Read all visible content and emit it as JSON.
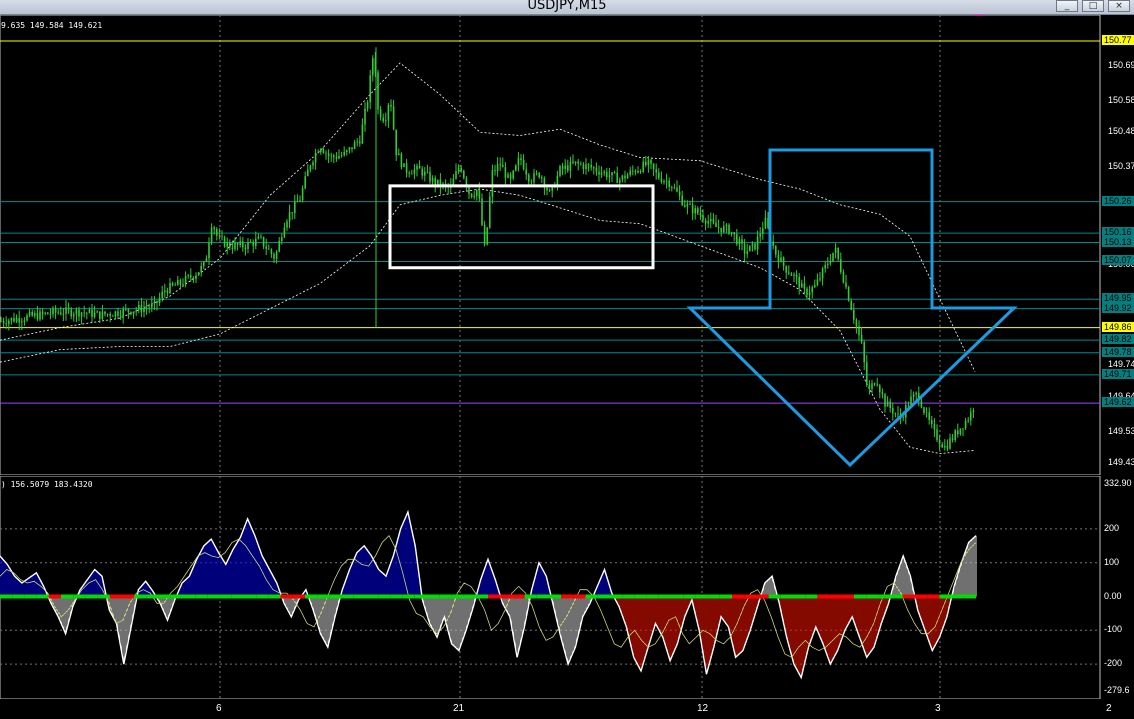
{
  "window": {
    "title": "USDJPY,M15",
    "buttons": {
      "minimize": "_",
      "maximize": "□",
      "close": "×"
    }
  },
  "price_info": "9.635 149.584 149.621",
  "indicator_info": ") 156.5079 183.4320",
  "price_axis": {
    "ticks": [
      {
        "label": "150.69",
        "value": 150.69
      },
      {
        "label": "150.58",
        "value": 150.58
      },
      {
        "label": "150.48",
        "value": 150.48
      },
      {
        "label": "150.37",
        "value": 150.37
      },
      {
        "label": "150.06",
        "value": 150.06
      },
      {
        "label": "149.74",
        "value": 149.74
      },
      {
        "label": "149.64",
        "value": 149.64
      },
      {
        "label": "149.53",
        "value": 149.53
      },
      {
        "label": "149.43",
        "value": 149.43
      }
    ],
    "highlighted_labels": [
      {
        "label": "150.77",
        "value": 150.77,
        "color": "#ffff00"
      },
      {
        "label": "150.26",
        "value": 150.26,
        "color": "#008080"
      },
      {
        "label": "150.16",
        "value": 150.16,
        "color": "#008080"
      },
      {
        "label": "150.13",
        "value": 150.13,
        "color": "#008080"
      },
      {
        "label": "150.07",
        "value": 150.07,
        "color": "#008080"
      },
      {
        "label": "149.95",
        "value": 149.95,
        "color": "#008080"
      },
      {
        "label": "149.92",
        "value": 149.92,
        "color": "#008080"
      },
      {
        "label": "149.86",
        "value": 149.86,
        "color": "#ffff00"
      },
      {
        "label": "149.82",
        "value": 149.82,
        "color": "#008080"
      },
      {
        "label": "149.78",
        "value": 149.78,
        "color": "#008080"
      },
      {
        "label": "149.71",
        "value": 149.71,
        "color": "#008080"
      },
      {
        "label": "149.62",
        "value": 149.62,
        "color": "#008080"
      }
    ]
  },
  "horizontal_levels": [
    {
      "value": 150.77,
      "color": "#ffff00"
    },
    {
      "value": 150.26,
      "color": "#008b8b"
    },
    {
      "value": 150.16,
      "color": "#008b8b"
    },
    {
      "value": 150.13,
      "color": "#008b8b"
    },
    {
      "value": 150.07,
      "color": "#008b8b"
    },
    {
      "value": 149.95,
      "color": "#008b8b"
    },
    {
      "value": 149.92,
      "color": "#008b8b"
    },
    {
      "value": 149.86,
      "color": "#ffff00"
    },
    {
      "value": 149.82,
      "color": "#008b8b"
    },
    {
      "value": 149.78,
      "color": "#008b8b"
    },
    {
      "value": 149.71,
      "color": "#008b8b"
    },
    {
      "value": 149.62,
      "color": "#a040ff"
    }
  ],
  "indicator_axis": {
    "ticks": [
      {
        "label": "332.90",
        "value": 332.9
      },
      {
        "label": "200",
        "value": 200
      },
      {
        "label": "100",
        "value": 100
      },
      {
        "label": "0.00",
        "value": 0
      },
      {
        "label": "-100",
        "value": -100
      },
      {
        "label": "-200",
        "value": -200
      },
      {
        "label": "-279.6",
        "value": -279.6
      }
    ]
  },
  "time_axis": {
    "labels": [
      "6",
      "21",
      "12",
      "3",
      "2"
    ]
  },
  "colors": {
    "candle": "#33cc33",
    "bands": "#ffffff",
    "annotation_box": "#ffffff",
    "down_arrow": "#1e9be0",
    "hist_up": "#0000cc",
    "hist_down": "#dd1100",
    "hist_neutral": "#bbbbbb",
    "signal_up": "#00dd00",
    "signal_down": "#ff0000"
  },
  "chart_data": {
    "type": "line",
    "symbol": "USDJPY",
    "timeframe": "M15",
    "ylim": [
      149.43,
      150.77
    ],
    "price_path": [
      [
        0,
        149.88
      ],
      [
        20,
        149.89
      ],
      [
        40,
        149.9
      ],
      [
        60,
        149.91
      ],
      [
        80,
        149.91
      ],
      [
        100,
        149.9
      ],
      [
        120,
        149.91
      ],
      [
        140,
        149.92
      ],
      [
        155,
        149.93
      ],
      [
        165,
        149.98
      ],
      [
        180,
        150.0
      ],
      [
        195,
        150.03
      ],
      [
        205,
        150.06
      ],
      [
        212,
        150.2
      ],
      [
        218,
        150.14
      ],
      [
        230,
        150.12
      ],
      [
        245,
        150.12
      ],
      [
        260,
        150.14
      ],
      [
        275,
        150.08
      ],
      [
        285,
        150.2
      ],
      [
        300,
        150.27
      ],
      [
        310,
        150.38
      ],
      [
        320,
        150.44
      ],
      [
        330,
        150.4
      ],
      [
        345,
        150.41
      ],
      [
        360,
        150.46
      ],
      [
        368,
        150.59
      ],
      [
        374,
        150.75
      ],
      [
        378,
        150.55
      ],
      [
        385,
        150.52
      ],
      [
        390,
        150.6
      ],
      [
        396,
        150.42
      ],
      [
        405,
        150.36
      ],
      [
        420,
        150.36
      ],
      [
        435,
        150.32
      ],
      [
        450,
        150.3
      ],
      [
        460,
        150.38
      ],
      [
        470,
        150.28
      ],
      [
        478,
        150.3
      ],
      [
        485,
        150.1
      ],
      [
        492,
        150.35
      ],
      [
        500,
        150.38
      ],
      [
        510,
        150.32
      ],
      [
        520,
        150.4
      ],
      [
        530,
        150.33
      ],
      [
        540,
        150.35
      ],
      [
        550,
        150.28
      ],
      [
        560,
        150.36
      ],
      [
        575,
        150.38
      ],
      [
        590,
        150.37
      ],
      [
        605,
        150.35
      ],
      [
        620,
        150.33
      ],
      [
        635,
        150.36
      ],
      [
        648,
        150.38
      ],
      [
        658,
        150.34
      ],
      [
        670,
        150.32
      ],
      [
        685,
        150.25
      ],
      [
        700,
        150.22
      ],
      [
        715,
        150.18
      ],
      [
        730,
        150.17
      ],
      [
        745,
        150.1
      ],
      [
        755,
        150.12
      ],
      [
        765,
        150.2
      ],
      [
        775,
        150.1
      ],
      [
        785,
        150.05
      ],
      [
        795,
        150.02
      ],
      [
        805,
        149.97
      ],
      [
        815,
        149.99
      ],
      [
        825,
        150.05
      ],
      [
        835,
        150.11
      ],
      [
        845,
        150.0
      ],
      [
        855,
        149.88
      ],
      [
        862,
        149.8
      ],
      [
        868,
        149.65
      ],
      [
        876,
        149.7
      ],
      [
        885,
        149.62
      ],
      [
        892,
        149.6
      ],
      [
        900,
        149.57
      ],
      [
        910,
        149.63
      ],
      [
        918,
        149.65
      ],
      [
        926,
        149.58
      ],
      [
        935,
        149.52
      ],
      [
        945,
        149.48
      ],
      [
        955,
        149.52
      ],
      [
        962,
        149.55
      ],
      [
        970,
        149.58
      ],
      [
        976,
        149.63
      ]
    ],
    "upper_band": [
      [
        0,
        149.82
      ],
      [
        60,
        149.86
      ],
      [
        120,
        149.89
      ],
      [
        170,
        149.96
      ],
      [
        220,
        150.08
      ],
      [
        270,
        150.28
      ],
      [
        320,
        150.42
      ],
      [
        370,
        150.6
      ],
      [
        400,
        150.7
      ],
      [
        440,
        150.6
      ],
      [
        480,
        150.48
      ],
      [
        520,
        150.47
      ],
      [
        560,
        150.49
      ],
      [
        600,
        150.44
      ],
      [
        640,
        150.4
      ],
      [
        700,
        150.39
      ],
      [
        760,
        150.33
      ],
      [
        800,
        150.3
      ],
      [
        840,
        150.25
      ],
      [
        880,
        150.22
      ],
      [
        910,
        150.15
      ],
      [
        940,
        149.95
      ],
      [
        975,
        149.72
      ]
    ],
    "lower_band": [
      [
        0,
        149.75
      ],
      [
        60,
        149.79
      ],
      [
        120,
        149.8
      ],
      [
        170,
        149.8
      ],
      [
        220,
        149.84
      ],
      [
        270,
        149.92
      ],
      [
        320,
        150.0
      ],
      [
        370,
        150.12
      ],
      [
        400,
        150.25
      ],
      [
        440,
        150.28
      ],
      [
        480,
        150.3
      ],
      [
        520,
        150.28
      ],
      [
        560,
        150.24
      ],
      [
        600,
        150.2
      ],
      [
        640,
        150.19
      ],
      [
        700,
        150.12
      ],
      [
        760,
        150.05
      ],
      [
        800,
        149.98
      ],
      [
        840,
        149.85
      ],
      [
        880,
        149.6
      ],
      [
        910,
        149.48
      ],
      [
        940,
        149.46
      ],
      [
        975,
        149.47
      ]
    ],
    "middle_band": [
      [
        0,
        149.78
      ],
      [
        60,
        149.81
      ],
      [
        120,
        149.84
      ],
      [
        170,
        149.9
      ],
      [
        220,
        149.99
      ],
      [
        270,
        150.11
      ],
      [
        320,
        150.22
      ],
      [
        370,
        150.35
      ],
      [
        400,
        150.45
      ],
      [
        440,
        150.42
      ],
      [
        480,
        150.38
      ],
      [
        520,
        150.38
      ],
      [
        560,
        150.37
      ],
      [
        600,
        150.36
      ],
      [
        640,
        150.34
      ],
      [
        700,
        150.28
      ],
      [
        760,
        150.18
      ],
      [
        800,
        150.12
      ],
      [
        840,
        150.03
      ],
      [
        880,
        149.9
      ],
      [
        910,
        149.78
      ],
      [
        940,
        149.7
      ],
      [
        975,
        149.6
      ]
    ],
    "annotations": {
      "box": {
        "x_start": 390,
        "x_end": 653,
        "price_top": 150.31,
        "price_bottom": 150.05
      },
      "down_arrow": {
        "note": "drawn as arrow shape spanning the drop"
      }
    },
    "indicator": {
      "ylim": [
        -279.6,
        332.9
      ],
      "zero": 0,
      "values": [
        120,
        95,
        60,
        40,
        55,
        70,
        30,
        -20,
        -60,
        -110,
        -30,
        20,
        50,
        80,
        60,
        -40,
        -80,
        -200,
        -90,
        20,
        45,
        15,
        -20,
        -70,
        -10,
        40,
        60,
        110,
        150,
        170,
        130,
        95,
        140,
        175,
        230,
        180,
        120,
        80,
        40,
        -20,
        -60,
        -10,
        20,
        -40,
        -110,
        -150,
        -60,
        20,
        80,
        130,
        150,
        120,
        80,
        60,
        120,
        200,
        250,
        150,
        -10,
        -80,
        -120,
        -60,
        -140,
        -160,
        -100,
        -30,
        50,
        110,
        50,
        -20,
        -60,
        -180,
        -90,
        20,
        100,
        60,
        -30,
        -120,
        -200,
        -150,
        -60,
        -20,
        30,
        80,
        10,
        -30,
        -90,
        -180,
        -220,
        -150,
        -80,
        -120,
        -190,
        -140,
        -60,
        -10,
        -100,
        -230,
        -150,
        -60,
        -90,
        -180,
        -160,
        -100,
        -30,
        40,
        60,
        -20,
        -120,
        -200,
        -240,
        -150,
        -90,
        -140,
        -200,
        -160,
        -100,
        -60,
        -120,
        -180,
        -150,
        -80,
        -20,
        60,
        120,
        60,
        -40,
        -100,
        -160,
        -120,
        -60,
        30,
        100,
        160,
        180
      ],
      "signal_values": [
        60,
        80,
        70,
        50,
        40,
        45,
        30,
        10,
        -30,
        -60,
        -40,
        -10,
        20,
        40,
        50,
        20,
        -20,
        -80,
        -70,
        -20,
        10,
        20,
        10,
        -20,
        -20,
        10,
        30,
        60,
        90,
        120,
        130,
        120,
        115,
        130,
        160,
        170,
        150,
        120,
        90,
        50,
        20,
        10,
        10,
        -10,
        -40,
        -80,
        -90,
        -50,
        0,
        50,
        90,
        110,
        110,
        95,
        90,
        120,
        160,
        180,
        140,
        70,
        -10,
        -50,
        -60,
        -90,
        -110,
        -90,
        -50,
        10,
        40,
        30,
        0,
        -40,
        -100,
        -80,
        -40,
        10,
        30,
        10,
        -30,
        -90,
        -130,
        -120,
        -90,
        -60,
        -20,
        20,
        20,
        0,
        -40,
        -90,
        -140,
        -150,
        -120,
        -100,
        -130,
        -150,
        -140,
        -110,
        -70,
        -60,
        -110,
        -140,
        -120,
        -100,
        -110,
        -130,
        -140,
        -120,
        -80,
        -30,
        10,
        20,
        -10,
        -60,
        -120,
        -170,
        -180,
        -150,
        -130,
        -150,
        -160,
        -150,
        -130,
        -110,
        -120,
        -140,
        -150,
        -120,
        -80,
        -20,
        30,
        40,
        10,
        -40,
        -80,
        -110,
        -110,
        -90,
        -40,
        10,
        60,
        110,
        140,
        160
      ],
      "signal_line_state": [
        "up",
        "up",
        "up",
        "up",
        "down",
        "up",
        "up",
        "up",
        "up",
        "down",
        "down",
        "up",
        "up",
        "up",
        "up",
        "up",
        "up",
        "up",
        "up",
        "up",
        "up",
        "up",
        "up",
        "down",
        "down",
        "up",
        "up",
        "up",
        "up",
        "up",
        "up",
        "up",
        "up",
        "up",
        "up",
        "up",
        "up",
        "up",
        "up",
        "up",
        "down",
        "down",
        "down",
        "up",
        "up",
        "up",
        "down",
        "down",
        "up",
        "up",
        "up",
        "up",
        "up",
        "up",
        "up",
        "up",
        "up",
        "up",
        "up",
        "up",
        "down",
        "down",
        "down",
        "up",
        "up",
        "up",
        "up",
        "down",
        "down",
        "down",
        "up",
        "up",
        "up",
        "up",
        "down",
        "down",
        "down",
        "up",
        "up",
        "up"
      ]
    }
  }
}
